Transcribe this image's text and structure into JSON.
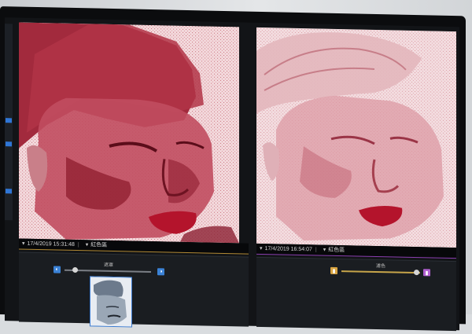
{
  "left_view": {
    "timestamp": "17/4/2019 15:31:48",
    "mode": "紅色區",
    "controls_label": "遮罩"
  },
  "right_view": {
    "timestamp": "17/4/2019 16:54:07",
    "mode": "紅色區",
    "controls_label": "濾色"
  },
  "colors": {
    "left_accent": "#b28a35",
    "right_accent": "#8b3fb0",
    "slider_left_btn": "#3b82d6",
    "slider_right_btn_left": "#d9a441",
    "slider_right_btn_right": "#b05fd0"
  },
  "icons": {
    "dropdown": "caret-down-icon",
    "contrast_low": "contrast-low-icon",
    "contrast_high": "contrast-high-icon"
  }
}
